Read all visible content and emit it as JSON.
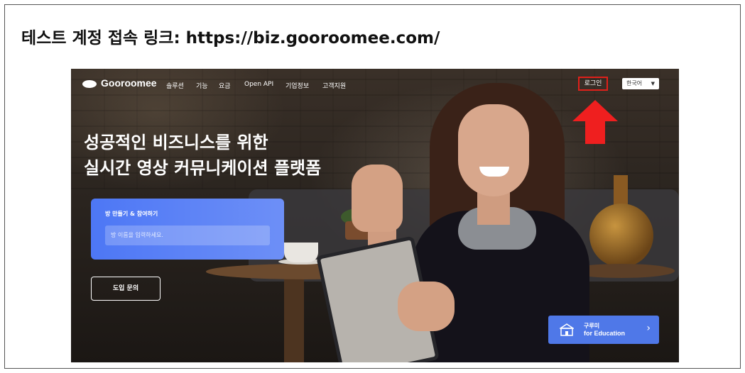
{
  "caption": "테스트 계정 접속 링크: https://biz.gooroomee.com/",
  "site": {
    "logo": "Gooroomee",
    "nav": [
      "솔루션",
      "기능",
      "요금",
      "Open API",
      "기업정보",
      "고객지원"
    ],
    "login_label": "로그인",
    "language": "한국어",
    "headline_line1": "성공적인 비즈니스를 위한",
    "headline_line2": "실시간 영상 커뮤니케이션 플랫폼",
    "room_card_label": "방 만들기 & 참여하기",
    "room_input_placeholder": "방 이름을 입력하세요.",
    "inquiry_button": "도입 문의",
    "edu_banner_line1": "구루미",
    "edu_banner_line2": "for Education"
  },
  "colors": {
    "highlight_box": "#e0201a",
    "arrow": "#ef1f1f",
    "accent": "#4d77f5"
  }
}
